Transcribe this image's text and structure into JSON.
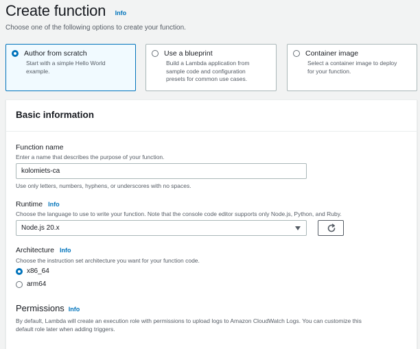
{
  "header": {
    "title": "Create function",
    "info_label": "Info",
    "subtitle": "Choose one of the following options to create your function."
  },
  "options": [
    {
      "title": "Author from scratch",
      "desc_lines": [
        "Start with a simple Hello World",
        "example."
      ],
      "selected": true
    },
    {
      "title": "Use a blueprint",
      "desc_lines": [
        "Build a Lambda application from",
        "sample code and configuration",
        "presets for common use cases."
      ],
      "selected": false
    },
    {
      "title": "Container image",
      "desc_lines": [
        "Select a container image to deploy",
        "for your function."
      ],
      "selected": false
    }
  ],
  "basic_info": {
    "heading": "Basic information",
    "function_name": {
      "label": "Function name",
      "description": "Enter a name that describes the purpose of your function.",
      "value": "kolomiets-ca",
      "hint": "Use only letters, numbers, hyphens, or underscores with no spaces."
    },
    "runtime": {
      "label": "Runtime",
      "info_label": "Info",
      "description": "Choose the language to use to write your function. Note that the console code editor supports only Node.js, Python, and Ruby.",
      "selected": "Node.js 20.x"
    },
    "architecture": {
      "label": "Architecture",
      "info_label": "Info",
      "description": "Choose the instruction set architecture you want for your function code.",
      "options": [
        {
          "label": "x86_64",
          "selected": true
        },
        {
          "label": "arm64",
          "selected": false
        }
      ]
    },
    "permissions": {
      "title": "Permissions",
      "info_label": "Info",
      "desc_lines": [
        "By default, Lambda will create an execution role with permissions to upload logs to Amazon CloudWatch Logs. You can customize this",
        "default role later when adding triggers."
      ]
    }
  },
  "colors": {
    "accent": "#0073bb",
    "selected_tile_bg": "#f1faff",
    "page_bg": "#f2f3f3",
    "muted_text": "#545b64"
  },
  "icons": {
    "refresh": "refresh-icon",
    "dropdown": "caret-down-icon"
  }
}
